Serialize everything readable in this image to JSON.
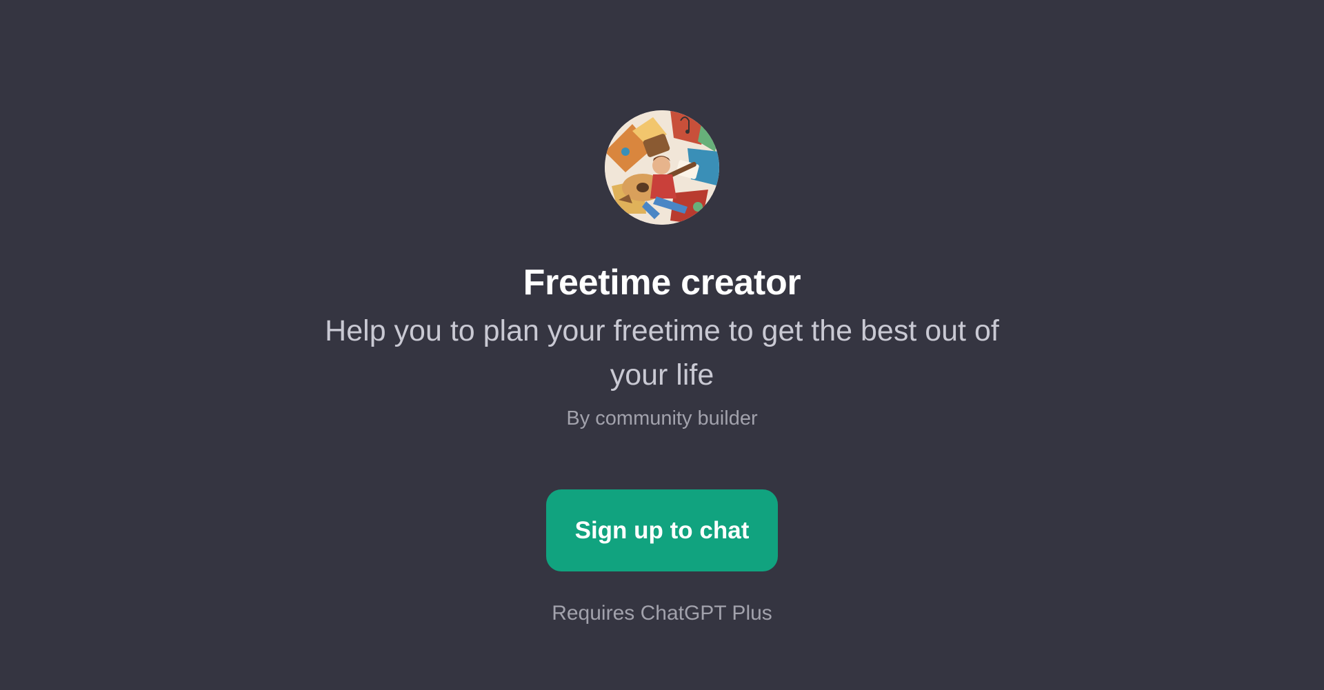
{
  "gpt": {
    "avatar_icon": "illustrated-guitar-leisure-avatar",
    "title": "Freetime creator",
    "description": "Help you to plan your freetime to get the best out of your life",
    "author": "By community builder"
  },
  "cta": {
    "signup_label": "Sign up to chat",
    "requirement": "Requires ChatGPT Plus"
  },
  "colors": {
    "background": "#353541",
    "accent": "#11a37f",
    "title_text": "#ffffff",
    "description_text": "#c9c9d3",
    "muted_text": "#a2a2ac"
  }
}
